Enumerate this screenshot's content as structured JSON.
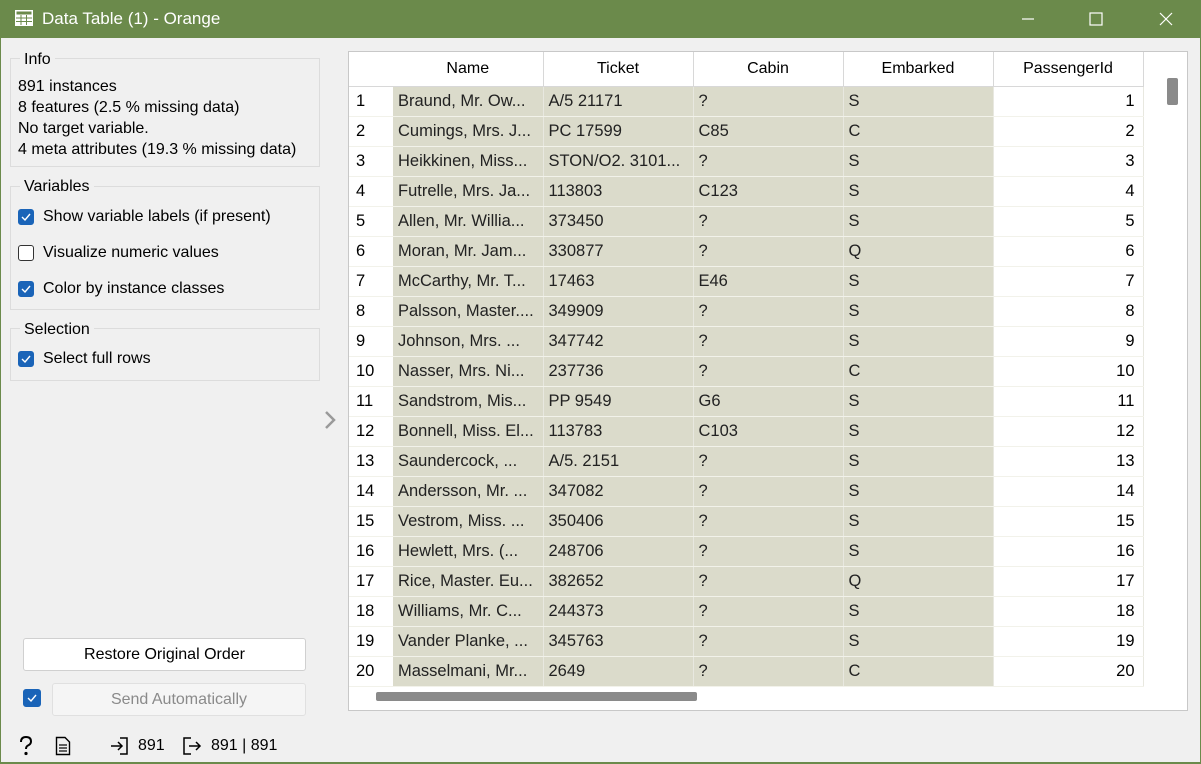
{
  "window": {
    "title": "Data Table (1) - Orange",
    "accent": "#6b8a4b"
  },
  "info": {
    "title": "Info",
    "lines": [
      "891 instances",
      "8  features (2.5 % missing data)",
      "No target variable.",
      "4 meta attributes (19.3 % missing data)"
    ]
  },
  "variables": {
    "title": "Variables",
    "show_labels": {
      "label": "Show variable labels (if present)",
      "checked": true
    },
    "visualize_numeric": {
      "label": "Visualize numeric values",
      "checked": false
    },
    "color_by_class": {
      "label": "Color by instance classes",
      "checked": true
    }
  },
  "selection": {
    "title": "Selection",
    "select_full_rows": {
      "label": "Select full rows",
      "checked": true
    }
  },
  "buttons": {
    "restore": "Restore Original Order",
    "send_auto": "Send Automatically",
    "send_auto_checked": true
  },
  "status": {
    "input_count": "891",
    "output_count": "891 | 891"
  },
  "table": {
    "columns": [
      "Name",
      "Ticket",
      "Cabin",
      "Embarked",
      "PassengerId"
    ],
    "rows": [
      [
        "1",
        "Braund, Mr. Ow...",
        "A/5 21171",
        "?",
        "S",
        "1"
      ],
      [
        "2",
        "Cumings, Mrs. J...",
        "PC 17599",
        "C85",
        "C",
        "2"
      ],
      [
        "3",
        "Heikkinen, Miss...",
        "STON/O2. 3101...",
        "?",
        "S",
        "3"
      ],
      [
        "4",
        "Futrelle, Mrs. Ja...",
        "113803",
        "C123",
        "S",
        "4"
      ],
      [
        "5",
        "Allen, Mr. Willia...",
        "373450",
        "?",
        "S",
        "5"
      ],
      [
        "6",
        "Moran, Mr. Jam...",
        "330877",
        "?",
        "Q",
        "6"
      ],
      [
        "7",
        "McCarthy, Mr. T...",
        "17463",
        "E46",
        "S",
        "7"
      ],
      [
        "8",
        "Palsson, Master....",
        "349909",
        "?",
        "S",
        "8"
      ],
      [
        "9",
        "Johnson, Mrs. ...",
        "347742",
        "?",
        "S",
        "9"
      ],
      [
        "10",
        "Nasser, Mrs. Ni...",
        "237736",
        "?",
        "C",
        "10"
      ],
      [
        "11",
        "Sandstrom, Mis...",
        "PP 9549",
        "G6",
        "S",
        "11"
      ],
      [
        "12",
        "Bonnell, Miss. El...",
        "113783",
        "C103",
        "S",
        "12"
      ],
      [
        "13",
        "Saundercock, ...",
        "A/5. 2151",
        "?",
        "S",
        "13"
      ],
      [
        "14",
        "Andersson, Mr. ...",
        "347082",
        "?",
        "S",
        "14"
      ],
      [
        "15",
        "Vestrom, Miss. ...",
        "350406",
        "?",
        "S",
        "15"
      ],
      [
        "16",
        "Hewlett, Mrs. (...",
        "248706",
        "?",
        "S",
        "16"
      ],
      [
        "17",
        "Rice, Master. Eu...",
        "382652",
        "?",
        "Q",
        "17"
      ],
      [
        "18",
        "Williams, Mr. C...",
        "244373",
        "?",
        "S",
        "18"
      ],
      [
        "19",
        "Vander Planke, ...",
        "345763",
        "?",
        "S",
        "19"
      ],
      [
        "20",
        "Masselmani, Mr...",
        "2649",
        "?",
        "C",
        "20"
      ]
    ]
  }
}
